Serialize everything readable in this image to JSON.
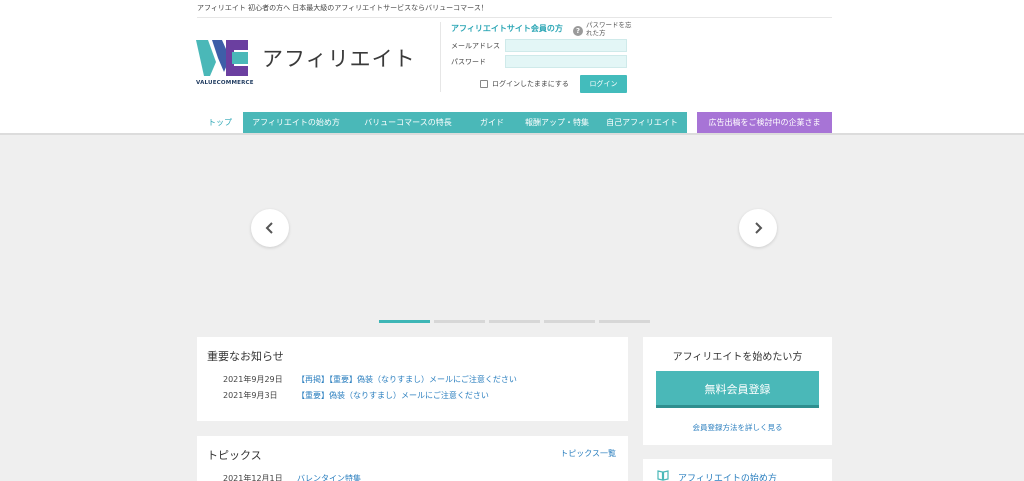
{
  "header": {
    "tagline": "アフィリエイト 初心者の方へ 日本最大級のアフィリエイトサービスならバリューコマース！",
    "logo_text": "VALUECOMMERCE",
    "site_title": "アフィリエイト"
  },
  "login": {
    "heading": "アフィリエイトサイト会員の方",
    "forgot_icon": "?",
    "forgot_label": "パスワードを忘れた方",
    "email_label": "メールアドレス",
    "password_label": "パスワード",
    "remember_label": "ログインしたままにする",
    "submit_label": "ログイン"
  },
  "nav": {
    "items": [
      {
        "label": "トップ",
        "active": true
      },
      {
        "label": "アフィリエイトの始め方"
      },
      {
        "label": "バリューコマースの特長"
      },
      {
        "label": "ガイド"
      },
      {
        "label": "報酬アップ・特集"
      },
      {
        "label": "自己アフィリエイト"
      }
    ],
    "advertiser_label": "広告出稿をご検討中の企業さま"
  },
  "carousel": {
    "prev_icon": "chevron-left-icon",
    "next_icon": "chevron-right-icon",
    "slide_count": 5,
    "active_index": 0
  },
  "news": {
    "title": "重要なお知らせ",
    "items": [
      {
        "date": "2021年9月29日",
        "text": "【再掲】【重要】偽装（なりすまし）メールにご注意ください"
      },
      {
        "date": "2021年9月3日",
        "text": "【重要】偽装（なりすまし）メールにご注意ください"
      }
    ]
  },
  "topics": {
    "title": "トピックス",
    "view_all": "トピックス一覧",
    "items": [
      {
        "date": "2021年12月1日",
        "text": "バレンタイン特集"
      }
    ]
  },
  "signup": {
    "title": "アフィリエイトを始めたい方",
    "button_label": "無料会員登録",
    "howto_link": "会員登録方法を詳しく見る"
  },
  "guide": {
    "label": "アフィリエイトの始め方",
    "icon": "book-icon"
  },
  "colors": {
    "brand_teal": "#4ab8b8",
    "advertiser_purple": "#a774d6",
    "link_blue": "#2b7fbf"
  }
}
